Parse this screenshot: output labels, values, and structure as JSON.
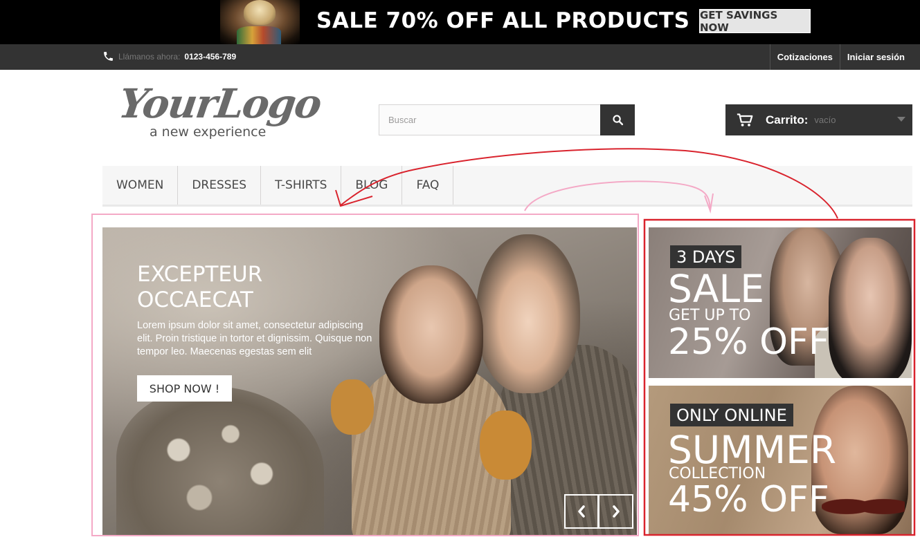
{
  "promo": {
    "title": "SALE 70% OFF ALL PRODUCTS",
    "cta": "GET SAVINGS NOW"
  },
  "utilbar": {
    "call_label": "Llámanos ahora:",
    "phone": "0123-456-789",
    "links": [
      "Cotizaciones",
      "Iniciar sesión"
    ]
  },
  "logo": {
    "script": "YourLogo",
    "tagline": "a new experience"
  },
  "search": {
    "placeholder": "Buscar"
  },
  "cart": {
    "label": "Carrito:",
    "value": "vacío"
  },
  "nav": [
    "WOMEN",
    "DRESSES",
    "T-SHIRTS",
    "BLOG",
    "FAQ"
  ],
  "slider": {
    "title": "EXCEPTEUR OCCAECAT",
    "text": "Lorem ipsum dolor sit amet, consectetur adipiscing elit. Proin tristique in tortor et dignissim. Quisque non tempor leo. Maecenas egestas sem elit",
    "button": "SHOP NOW !"
  },
  "banners": [
    {
      "pill": "3 DAYS",
      "big": "SALE",
      "mid": "GET UP TO",
      "pct": "25% OFF"
    },
    {
      "pill": "ONLY ONLINE",
      "big": "SUMMER",
      "mid": "COLLECTION",
      "pct": "45% OFF"
    }
  ],
  "annotation_colors": {
    "pink": "#f4a9c6",
    "red": "#d9232d"
  }
}
